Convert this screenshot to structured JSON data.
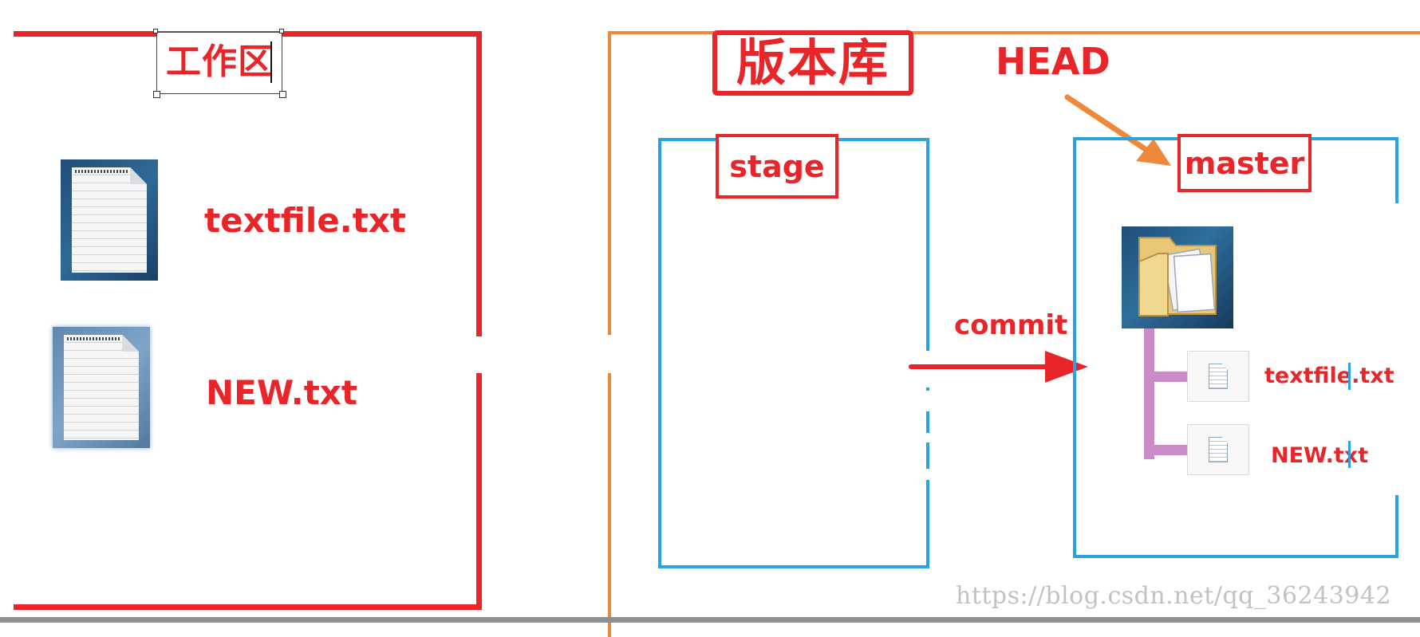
{
  "workspace": {
    "title": "工作区",
    "files": [
      {
        "name": "textfile.txt",
        "icon": "text-file-icon"
      },
      {
        "name": "NEW.txt",
        "icon": "text-file-icon"
      }
    ]
  },
  "repository": {
    "title": "版本库",
    "head_label": "HEAD",
    "stage": {
      "label": "stage"
    },
    "master": {
      "label": "master",
      "folder_icon": "folder-icon",
      "files": [
        {
          "name": "textfile.txt",
          "icon": "small-file-icon"
        },
        {
          "name": "NEW.txt",
          "icon": "small-file-icon"
        }
      ]
    },
    "commit_label": "commit"
  },
  "watermark": "https://blog.csdn.net/qq_36243942",
  "colors": {
    "red": "#e8262a",
    "orange": "#f0883a",
    "blue": "#2aa4e0",
    "tree": "#c98cc6"
  }
}
